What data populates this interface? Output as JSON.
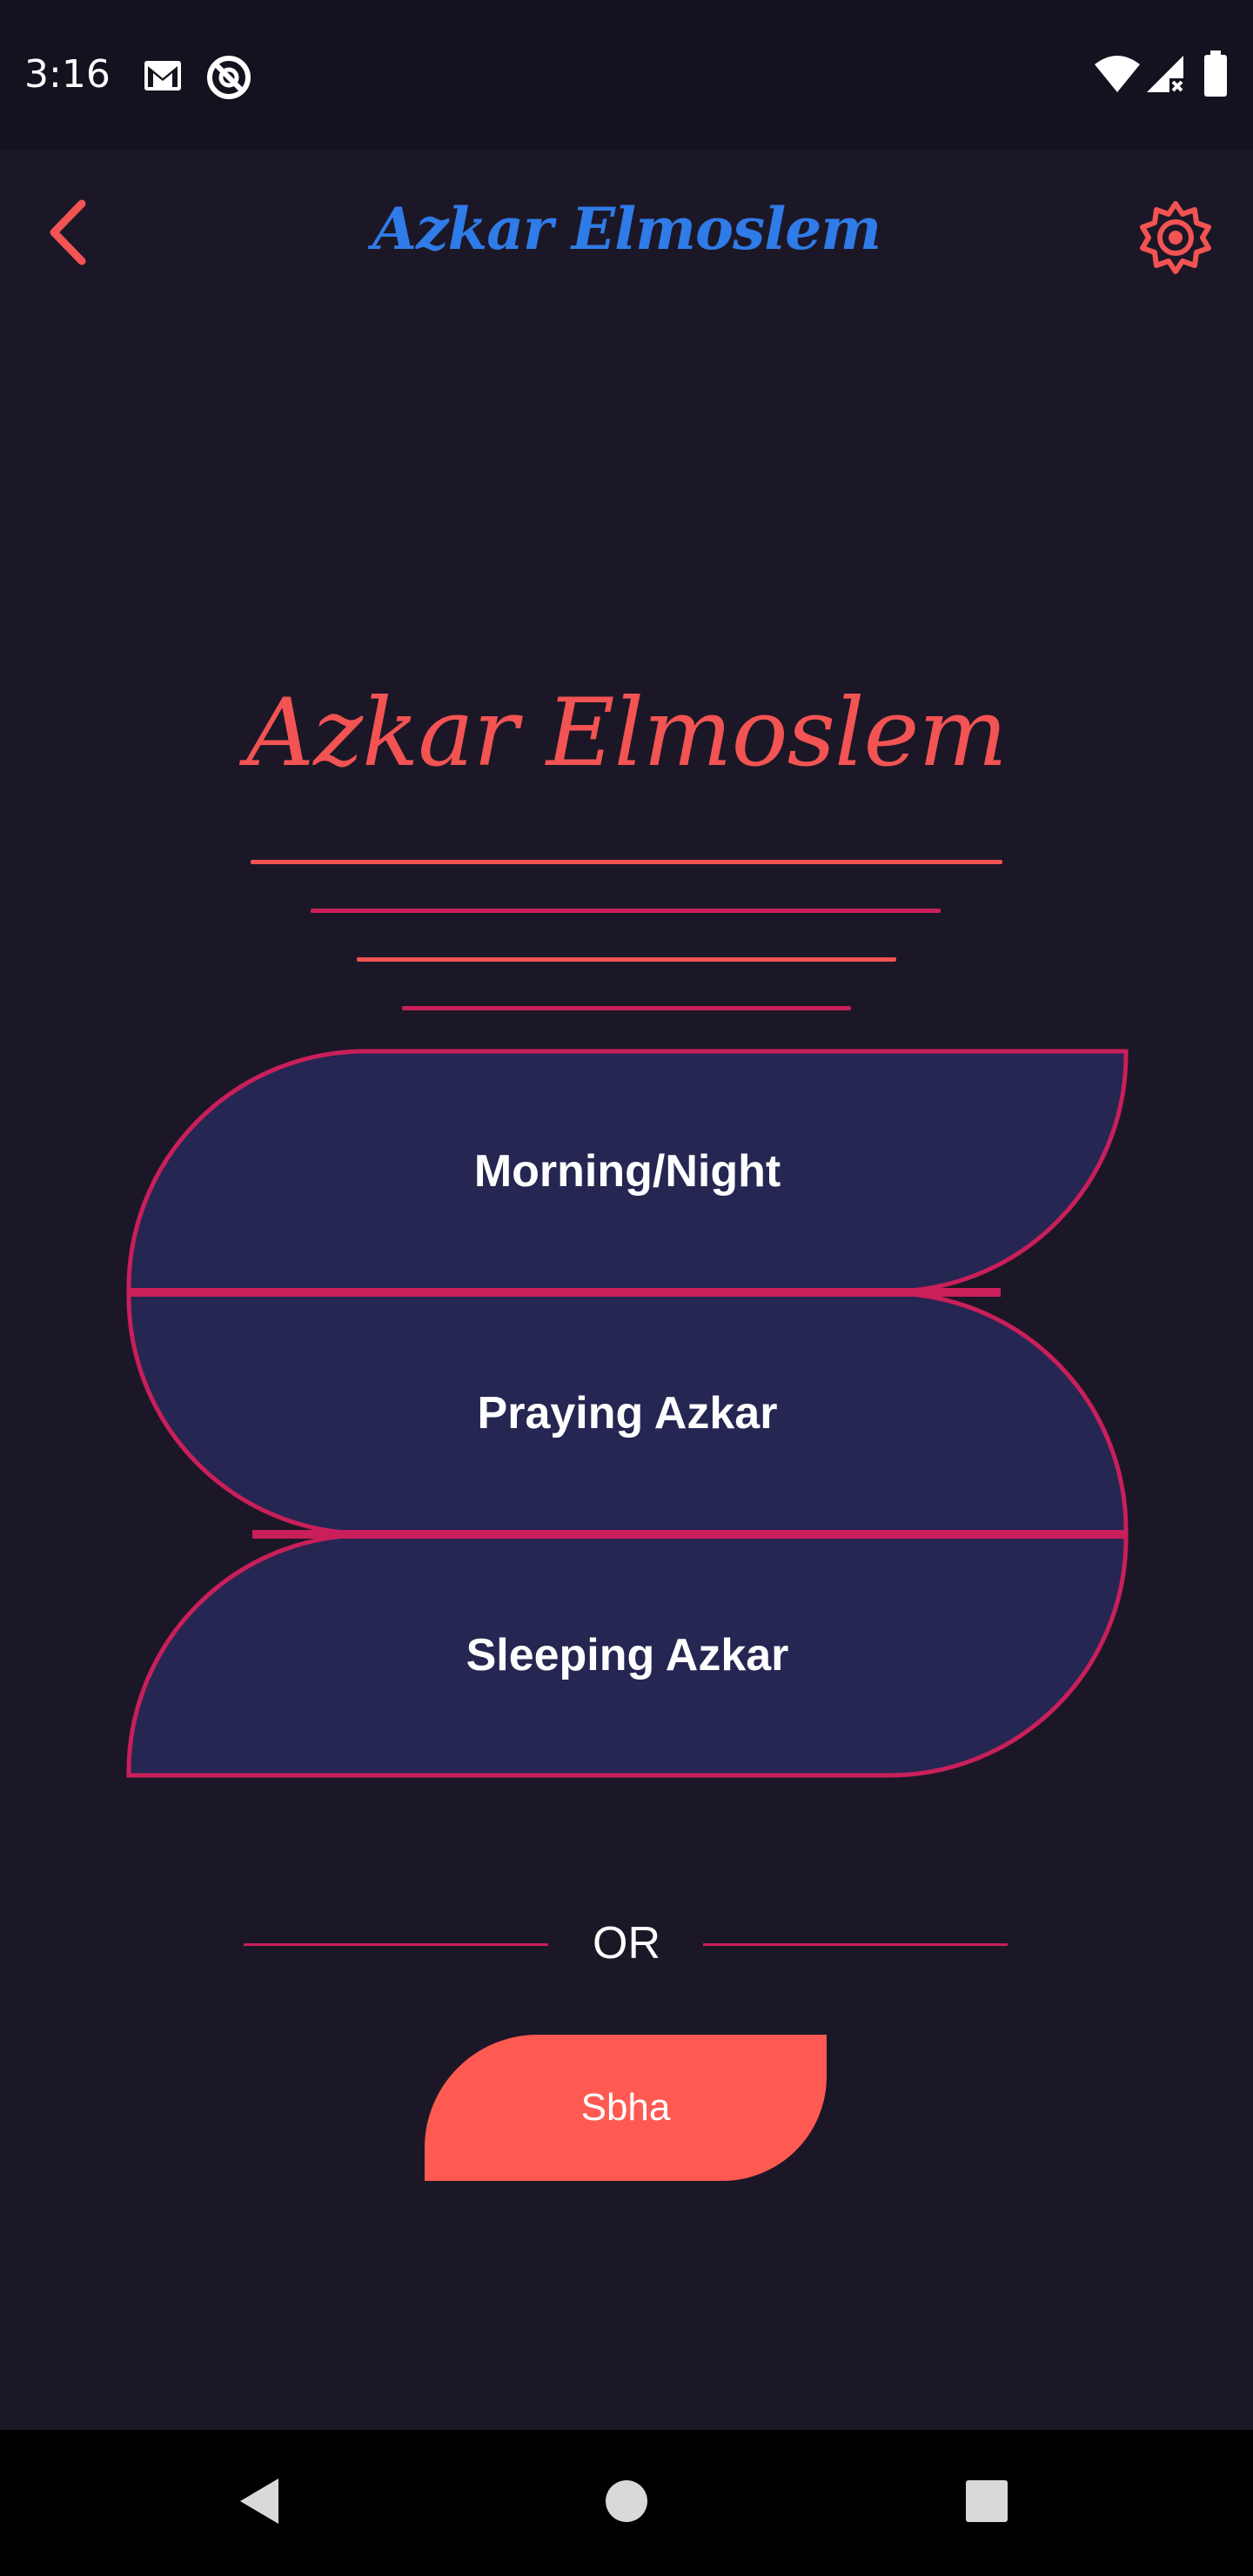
{
  "status_bar": {
    "time": "3:16",
    "icons": [
      "gmail-icon",
      "do-not-disturb-icon",
      "wifi-icon",
      "signal-icon",
      "battery-icon"
    ]
  },
  "app_bar": {
    "title": "Azkar Elmoslem",
    "back_icon": "chevron-left-icon",
    "settings_icon": "gear-icon"
  },
  "hero": {
    "title": "Azkar Elmoslem"
  },
  "menu": {
    "items": [
      {
        "label": "Morning/Night"
      },
      {
        "label": "Praying Azkar"
      },
      {
        "label": "Sleeping Azkar"
      }
    ]
  },
  "divider": {
    "label": "OR"
  },
  "sbha": {
    "label": "Sbha"
  },
  "nav_bar": {
    "icons": [
      "back-triangle-icon",
      "home-circle-icon",
      "recents-square-icon"
    ]
  },
  "colors": {
    "background": "#1c1726",
    "accent": "#f25353",
    "title_blue": "#2f7be8",
    "menu_fill": "#262652",
    "menu_border": "#c91f5a",
    "sbha_fill": "#ff5a52"
  }
}
